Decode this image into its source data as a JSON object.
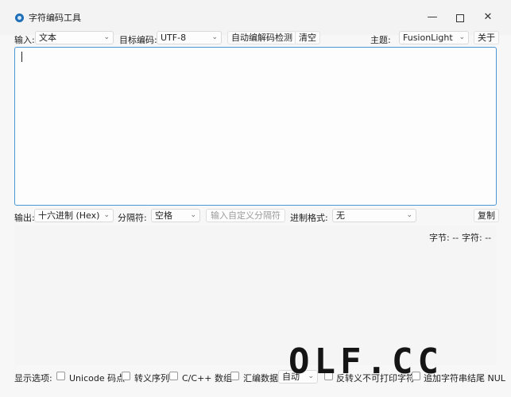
{
  "window": {
    "title": "字符编码工具",
    "controls": {
      "minimize": "—",
      "close": "✕"
    }
  },
  "toolbar": {
    "input_label": "输入:",
    "input_type": "文本",
    "target_encoding_label": "目标编码:",
    "target_encoding": "UTF-8",
    "auto_detect_button": "自动编解码检测",
    "clear_button": "清空",
    "theme_label": "主题:",
    "theme": "FusionLight",
    "about_button": "关于"
  },
  "output_toolbar": {
    "output_label": "输出:",
    "output_format": "十六进制 (Hex)",
    "separator_label": "分隔符:",
    "separator": "空格",
    "custom_separator_placeholder": "输入自定义分隔符",
    "radix_format_label": "进制格式:",
    "radix_format": "无",
    "copy_button": "复制"
  },
  "stats": {
    "bytes": "字节: --",
    "chars": "字符: --"
  },
  "display_options": {
    "label": "显示选项:",
    "unicode_codepoint": "Unicode 码点",
    "escape_sequence": "转义序列",
    "c_array": "C/C++ 数组",
    "asm_data": "汇编数据",
    "asm_mode": "自动",
    "reverse_escape": "反转义不可打印字符",
    "append_nul": "追加字符串结尾 NUL"
  },
  "watermark": "OLF.CC",
  "icons": {
    "dropdown": "chevron-down-icon",
    "app": "app-icon"
  }
}
